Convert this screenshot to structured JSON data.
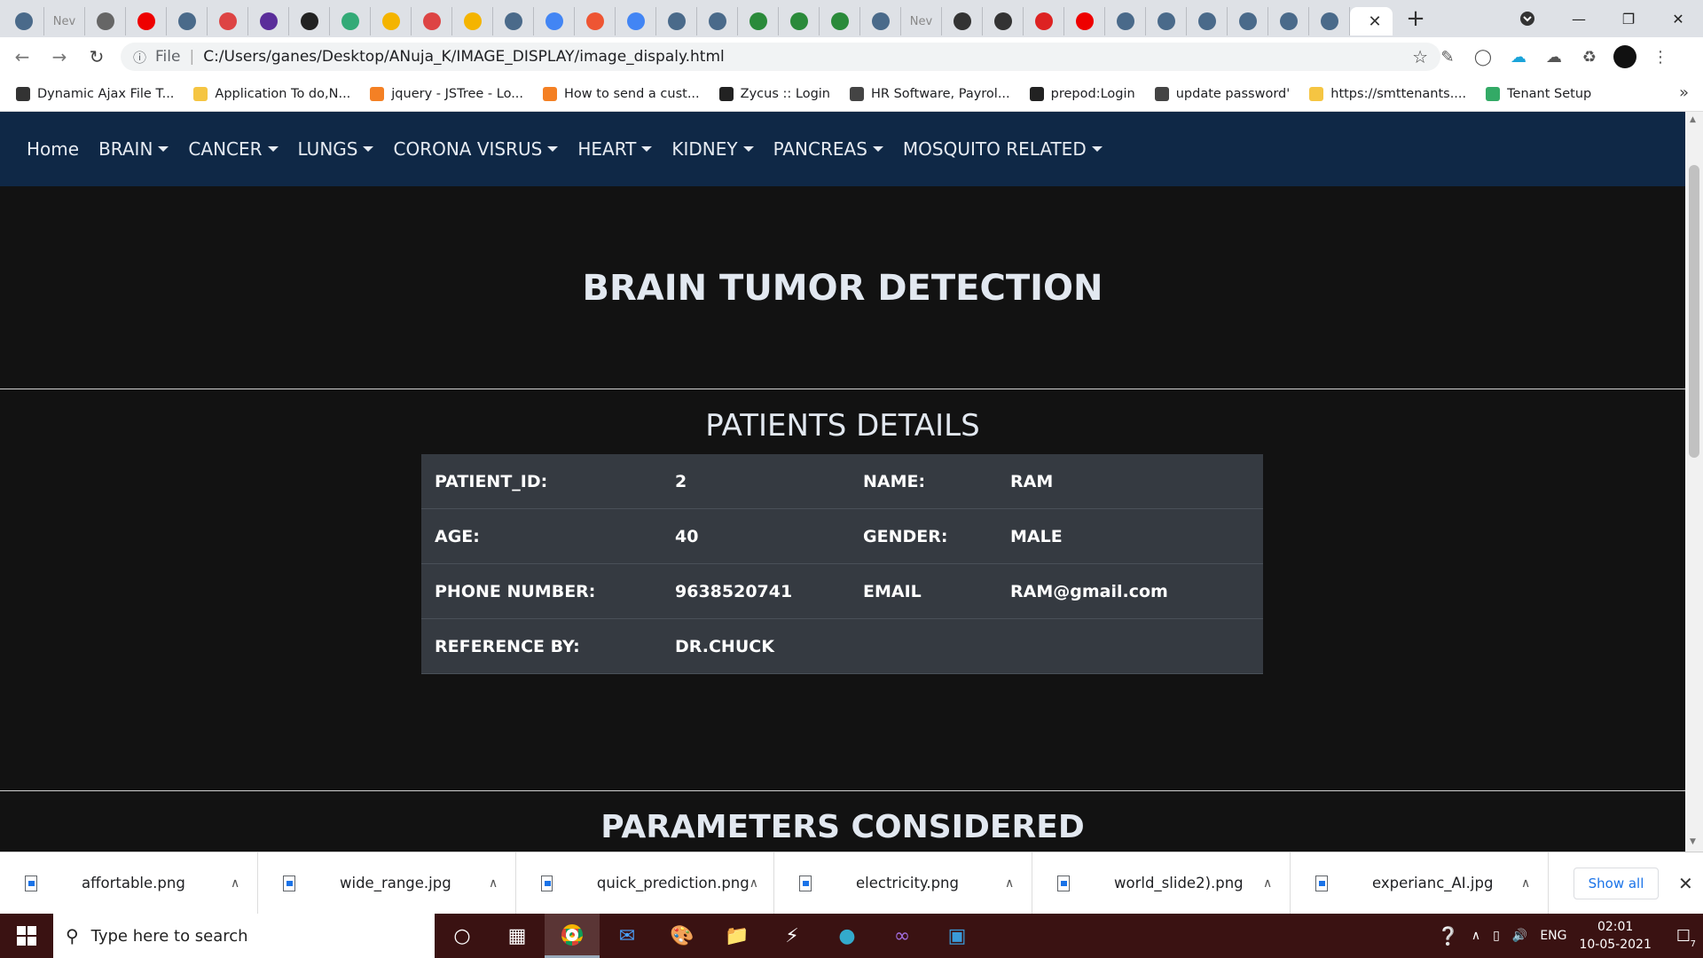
{
  "browser": {
    "tabs": [
      {
        "icon": "ie-icon",
        "color": "#4a6a8a",
        "text": ""
      },
      {
        "icon": "newtab-icon",
        "color": "#888",
        "text": "Nev"
      },
      {
        "icon": "globe-icon",
        "color": "#666",
        "text": ""
      },
      {
        "icon": "youtube-icon",
        "color": "#e00",
        "text": ""
      },
      {
        "icon": "ie-icon",
        "color": "#4a6a8a",
        "text": ""
      },
      {
        "icon": "gmail-icon",
        "color": "#d44",
        "text": ""
      },
      {
        "icon": "list-icon",
        "color": "#5a2d9a",
        "text": ""
      },
      {
        "icon": "github-icon",
        "color": "#222",
        "text": ""
      },
      {
        "icon": "b-icon",
        "color": "#3a7",
        "text": ""
      },
      {
        "icon": "drive-icon",
        "color": "#f4b400",
        "text": ""
      },
      {
        "icon": "gmail-icon",
        "color": "#d44",
        "text": ""
      },
      {
        "icon": "drive-icon",
        "color": "#f4b400",
        "text": ""
      },
      {
        "icon": "ie-icon",
        "color": "#4a6a8a",
        "text": ""
      },
      {
        "icon": "google-icon",
        "color": "#4285f4",
        "text": ""
      },
      {
        "icon": "app-icon",
        "color": "#e53",
        "text": ""
      },
      {
        "icon": "google-icon",
        "color": "#4285f4",
        "text": ""
      },
      {
        "icon": "ie-icon",
        "color": "#4a6a8a",
        "text": ""
      },
      {
        "icon": "ie-icon",
        "color": "#4a6a8a",
        "text": ""
      },
      {
        "icon": "w-icon",
        "color": "#2a8a3a",
        "text": ""
      },
      {
        "icon": "w-icon",
        "color": "#2a8a3a",
        "text": ""
      },
      {
        "icon": "w-icon",
        "color": "#2a8a3a",
        "text": ""
      },
      {
        "icon": "ie-icon",
        "color": "#4a6a8a",
        "text": ""
      },
      {
        "icon": "newtab-icon",
        "color": "#888",
        "text": "Nev"
      },
      {
        "icon": "diamond-icon",
        "color": "#333",
        "text": ""
      },
      {
        "icon": "diamond-icon",
        "color": "#333",
        "text": ""
      },
      {
        "icon": "v-icon",
        "color": "#d22",
        "text": ""
      },
      {
        "icon": "youtube-icon",
        "color": "#e00",
        "text": ""
      },
      {
        "icon": "ie-icon",
        "color": "#4a6a8a",
        "text": ""
      },
      {
        "icon": "ie-icon",
        "color": "#4a6a8a",
        "text": ""
      },
      {
        "icon": "ie-icon",
        "color": "#4a6a8a",
        "text": ""
      },
      {
        "icon": "ie-icon",
        "color": "#4a6a8a",
        "text": ""
      },
      {
        "icon": "ie-icon",
        "color": "#4a6a8a",
        "text": ""
      },
      {
        "icon": "ie-icon",
        "color": "#4a6a8a",
        "text": ""
      }
    ],
    "address": {
      "label": "File",
      "url": "C:/Users/ganes/Desktop/ANuja_K/IMAGE_DISPLAY/image_dispaly.html"
    },
    "bookmarks": [
      {
        "label": "Dynamic Ajax File T...",
        "color": "#333"
      },
      {
        "label": "Application To do,N...",
        "color": "#f5c542"
      },
      {
        "label": "jquery - JSTree - Lo...",
        "color": "#f48024"
      },
      {
        "label": "How to send a cust...",
        "color": "#f48024"
      },
      {
        "label": "Zycus :: Login",
        "color": "#222"
      },
      {
        "label": "HR Software, Payrol...",
        "color": "#444"
      },
      {
        "label": "prepod:Login",
        "color": "#222"
      },
      {
        "label": "update password'",
        "color": "#444"
      },
      {
        "label": "https://smttenants....",
        "color": "#f5c542"
      },
      {
        "label": "Tenant Setup",
        "color": "#3a6"
      }
    ]
  },
  "navbar": {
    "items": [
      {
        "label": "Home",
        "dropdown": false
      },
      {
        "label": "BRAIN",
        "dropdown": true
      },
      {
        "label": "CANCER",
        "dropdown": true
      },
      {
        "label": "LUNGS",
        "dropdown": true
      },
      {
        "label": "CORONA VISRUS",
        "dropdown": true
      },
      {
        "label": "HEART",
        "dropdown": true
      },
      {
        "label": "KIDNEY",
        "dropdown": true
      },
      {
        "label": "PANCREAS",
        "dropdown": true
      },
      {
        "label": "MOSQUITO RELATED",
        "dropdown": true
      }
    ]
  },
  "page": {
    "title": "BRAIN TUMOR DETECTION",
    "subtitle": "PATIENTS DETAILS",
    "section2": "PARAMETERS CONSIDERED",
    "rows": [
      [
        "PATIENT_ID:",
        "2",
        "NAME:",
        "RAM"
      ],
      [
        "AGE:",
        "40",
        "GENDER:",
        "MALE"
      ],
      [
        "PHONE NUMBER:",
        "9638520741",
        "EMAIL",
        "RAM@gmail.com"
      ],
      [
        "REFERENCE BY:",
        "DR.CHUCK",
        "",
        ""
      ]
    ]
  },
  "downloads": {
    "files": [
      "affortable.png",
      "wide_range.jpg",
      "quick_prediction.png",
      "electricity.png",
      "world_slide2).png",
      "experianc_AI.jpg"
    ],
    "show_all": "Show all"
  },
  "taskbar": {
    "search_placeholder": "Type here to search",
    "lang": "ENG",
    "time": "02:01",
    "date": "10-05-2021",
    "notif_count": "7"
  }
}
